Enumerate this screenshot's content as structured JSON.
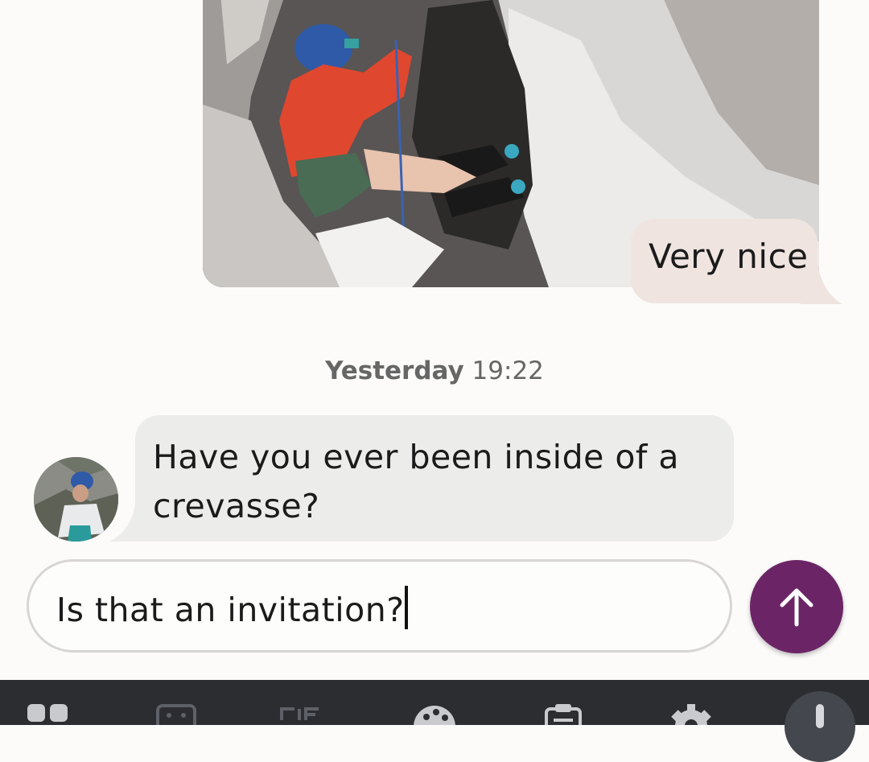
{
  "messages": {
    "sent_photo_alt": "",
    "sent_text": "Very nice",
    "timestamp_day": "Yesterday",
    "timestamp_time": "19:22",
    "received_text_line1": "Have you ever been inside of a",
    "received_text_line2": "crevasse?"
  },
  "composer": {
    "value": "Is that an invitation?"
  },
  "colors": {
    "send_button": "#6b2566",
    "sent_bubble": "#efe4e0",
    "received_bubble": "#ececeb",
    "keyboard_bar": "#2b2d31"
  },
  "keyboard_toolbar": {
    "icons": [
      "apps-icon",
      "sticker-icon",
      "gif-icon",
      "palette-icon",
      "clipboard-icon",
      "settings-icon",
      "microphone-icon"
    ]
  }
}
